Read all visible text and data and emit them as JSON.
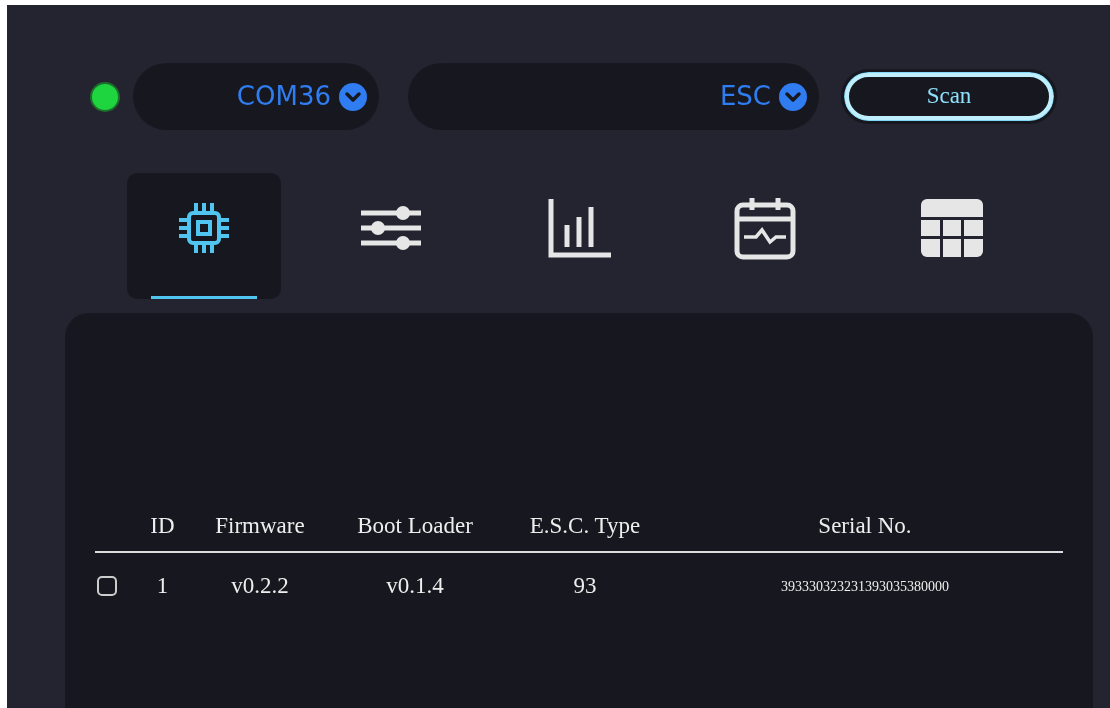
{
  "connection": {
    "connected": true
  },
  "port_select": {
    "value": "COM36"
  },
  "device_select": {
    "value": "ESC"
  },
  "scan_button": {
    "label": "Scan"
  },
  "tabs": [
    {
      "kind": "chip",
      "selected": true
    },
    {
      "kind": "sliders",
      "selected": false
    },
    {
      "kind": "chart",
      "selected": false
    },
    {
      "kind": "calendar",
      "selected": false
    },
    {
      "kind": "table",
      "selected": false
    }
  ],
  "table": {
    "columns": [
      "ID",
      "Firmware",
      "Boot Loader",
      "E.S.C. Type",
      "Serial No."
    ],
    "rows": [
      {
        "checked": false,
        "cells": [
          "1",
          "v0.2.2",
          "v0.1.4",
          "93",
          "393330323231393035380000"
        ]
      }
    ]
  }
}
